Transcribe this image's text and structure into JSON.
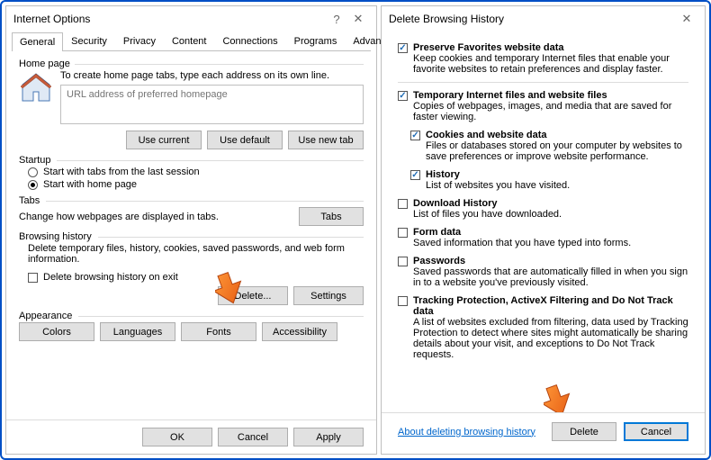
{
  "left": {
    "title": "Internet Options",
    "tabs": [
      "General",
      "Security",
      "Privacy",
      "Content",
      "Connections",
      "Programs",
      "Advanced"
    ],
    "homepage": {
      "legend": "Home page",
      "text": "To create home page tabs, type each address on its own line.",
      "placeholder": "URL address of preferred homepage",
      "buttons": {
        "current": "Use current",
        "default": "Use default",
        "newtab": "Use new tab"
      }
    },
    "startup": {
      "legend": "Startup",
      "opt1": "Start with tabs from the last session",
      "opt2": "Start with home page"
    },
    "tabsGroup": {
      "legend": "Tabs",
      "text": "Change how webpages are displayed in tabs.",
      "button": "Tabs"
    },
    "history": {
      "legend": "Browsing history",
      "text": "Delete temporary files, history, cookies, saved passwords, and web form information.",
      "check": "Delete browsing history on exit",
      "delete": "Delete...",
      "settings": "Settings"
    },
    "appearance": {
      "legend": "Appearance",
      "colors": "Colors",
      "languages": "Languages",
      "fonts": "Fonts",
      "accessibility": "Accessibility"
    },
    "footer": {
      "ok": "OK",
      "cancel": "Cancel",
      "apply": "Apply"
    }
  },
  "right": {
    "title": "Delete Browsing History",
    "options": [
      {
        "checked": true,
        "indent": false,
        "label": "Preserve Favorites website data",
        "desc": "Keep cookies and temporary Internet files that enable your favorite websites to retain preferences and display faster.",
        "sep": true
      },
      {
        "checked": true,
        "indent": false,
        "label": "Temporary Internet files and website files",
        "desc": "Copies of webpages, images, and media that are saved for faster viewing."
      },
      {
        "checked": true,
        "indent": true,
        "label": "Cookies and website data",
        "desc": "Files or databases stored on your computer by websites to save preferences or improve website performance."
      },
      {
        "checked": true,
        "indent": true,
        "label": "History",
        "desc": "List of websites you have visited."
      },
      {
        "checked": false,
        "indent": false,
        "label": "Download History",
        "desc": "List of files you have downloaded."
      },
      {
        "checked": false,
        "indent": false,
        "label": "Form data",
        "desc": "Saved information that you have typed into forms."
      },
      {
        "checked": false,
        "indent": false,
        "label": "Passwords",
        "desc": "Saved passwords that are automatically filled in when you sign in to a website you've previously visited."
      },
      {
        "checked": false,
        "indent": false,
        "label": "Tracking Protection, ActiveX Filtering and Do Not Track data",
        "desc": "A list of websites excluded from filtering, data used by Tracking Protection to detect where sites might automatically be sharing details about your visit, and exceptions to Do Not Track requests."
      }
    ],
    "link": "About deleting browsing history",
    "delete": "Delete",
    "cancel": "Cancel"
  }
}
